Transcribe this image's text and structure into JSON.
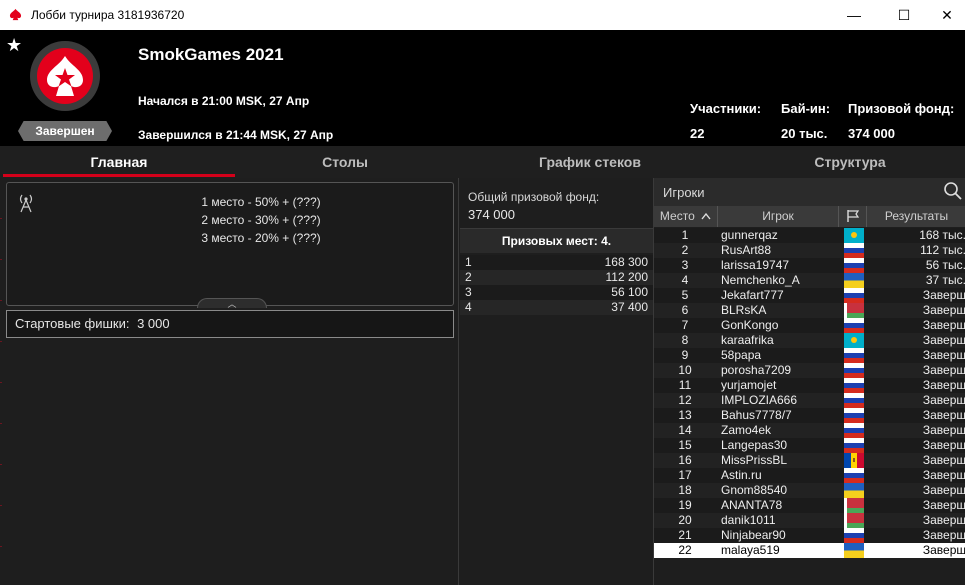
{
  "window": {
    "title": "Лобби турнира 3181936720",
    "minimize": "—",
    "maximize": "☐",
    "close": "✕"
  },
  "header": {
    "favorite": "★",
    "name": "SmokGames 2021",
    "status_badge": "Завершен",
    "started": "Начался в 21:00 MSK, 27 Апр",
    "ended": "Завершился в 21:44 MSK, 27 Апр",
    "stats": [
      {
        "label": "Участники:",
        "value": "22"
      },
      {
        "label": "Бай-ин:",
        "value": "20 тыс."
      },
      {
        "label": "Призовой фонд:",
        "value": "374 000"
      }
    ]
  },
  "tabs": [
    {
      "label": "Главная",
      "active": true
    },
    {
      "label": "Столы",
      "active": false
    },
    {
      "label": "График стеков",
      "active": false
    },
    {
      "label": "Структура",
      "active": false
    }
  ],
  "main": {
    "payout_lines": [
      "1 место - 50% + (???)",
      "2 место - 30% + (???)",
      "3 место - 20% + (???)"
    ],
    "collapse_handle": "︿",
    "starting_chips_label": "Стартовые фишки:",
    "starting_chips_value": "3 000"
  },
  "prize_pool": {
    "label": "Общий призовой фонд:",
    "value": "374 000",
    "places_header": "Призовых мест: 4.",
    "places": [
      {
        "place": "1",
        "amount": "168 300"
      },
      {
        "place": "2",
        "amount": "112 200"
      },
      {
        "place": "3",
        "amount": "56 100"
      },
      {
        "place": "4",
        "amount": "37 400"
      }
    ]
  },
  "players": {
    "search_label": "Игроки",
    "columns": {
      "place": "Место",
      "player": "Игрок",
      "results": "Результаты"
    },
    "rows": [
      {
        "place": "1",
        "name": "gunnerqaz",
        "flag": "kz",
        "result": "168 тыс."
      },
      {
        "place": "2",
        "name": "RusArt88",
        "flag": "ru",
        "result": "112 тыс."
      },
      {
        "place": "3",
        "name": "larissa19747",
        "flag": "ru",
        "result": "56 тыс."
      },
      {
        "place": "4",
        "name": "Nemchenko_A",
        "flag": "ua",
        "result": "37 тыс."
      },
      {
        "place": "5",
        "name": "Jekafart777",
        "flag": "ru",
        "result": "Заверш"
      },
      {
        "place": "6",
        "name": "BLRsKA",
        "flag": "by",
        "result": "Заверш"
      },
      {
        "place": "7",
        "name": "GonKongo",
        "flag": "ru",
        "result": "Заверш"
      },
      {
        "place": "8",
        "name": "karaafrika",
        "flag": "kz",
        "result": "Заверш"
      },
      {
        "place": "9",
        "name": "58papa",
        "flag": "ru",
        "result": "Заверш"
      },
      {
        "place": "10",
        "name": "porosha7209",
        "flag": "ru",
        "result": "Заверш"
      },
      {
        "place": "11",
        "name": "yurjamojet",
        "flag": "ru",
        "result": "Заверш"
      },
      {
        "place": "12",
        "name": "IMPLOZIA666",
        "flag": "ru",
        "result": "Заверш"
      },
      {
        "place": "13",
        "name": "Bahus7778/7",
        "flag": "ru",
        "result": "Заверш"
      },
      {
        "place": "14",
        "name": "Zamo4ek",
        "flag": "ru",
        "result": "Заверш"
      },
      {
        "place": "15",
        "name": "Langepas30",
        "flag": "ru",
        "result": "Заверш"
      },
      {
        "place": "16",
        "name": "MissPrissBL",
        "flag": "md",
        "result": "Заверш"
      },
      {
        "place": "17",
        "name": "Astin.ru",
        "flag": "ru",
        "result": "Заверш"
      },
      {
        "place": "18",
        "name": "Gnom88540",
        "flag": "ua",
        "result": "Заверш"
      },
      {
        "place": "19",
        "name": "ANANTA78",
        "flag": "by",
        "result": "Заверш"
      },
      {
        "place": "20",
        "name": "danik1011",
        "flag": "by",
        "result": "Заверш"
      },
      {
        "place": "21",
        "name": "Ninjabear90",
        "flag": "ru",
        "result": "Заверш"
      },
      {
        "place": "22",
        "name": "malaya519",
        "flag": "ua",
        "result": "Заверш"
      }
    ],
    "selected_index": 21
  }
}
